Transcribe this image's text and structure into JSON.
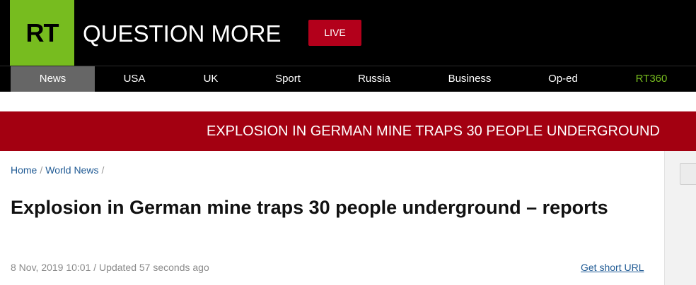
{
  "header": {
    "logo_text": "RT",
    "tagline": "QUESTION MORE",
    "live_label": "LIVE"
  },
  "nav": {
    "items": [
      {
        "label": "News"
      },
      {
        "label": "USA"
      },
      {
        "label": "UK"
      },
      {
        "label": "Sport"
      },
      {
        "label": "Russia"
      },
      {
        "label": "Business"
      },
      {
        "label": "Op-ed"
      },
      {
        "label": "RT360"
      }
    ],
    "active": "News"
  },
  "banner": {
    "text": "EXPLOSION IN GERMAN MINE TRAPS 30 PEOPLE UNDERGROUND"
  },
  "breadcrumb": {
    "items": [
      {
        "label": "Home"
      },
      {
        "label": "World News"
      }
    ],
    "separator": "/"
  },
  "article": {
    "headline": "Explosion in German mine traps 30 people underground – reports",
    "meta": "8 Nov, 2019 10:01 / Updated 57 seconds ago",
    "short_url_label": "Get short URL"
  },
  "colors": {
    "brand_green": "#77bc1f",
    "live_red": "#b3001b",
    "banner_red": "#a30011",
    "link_blue": "#1f5a94"
  }
}
